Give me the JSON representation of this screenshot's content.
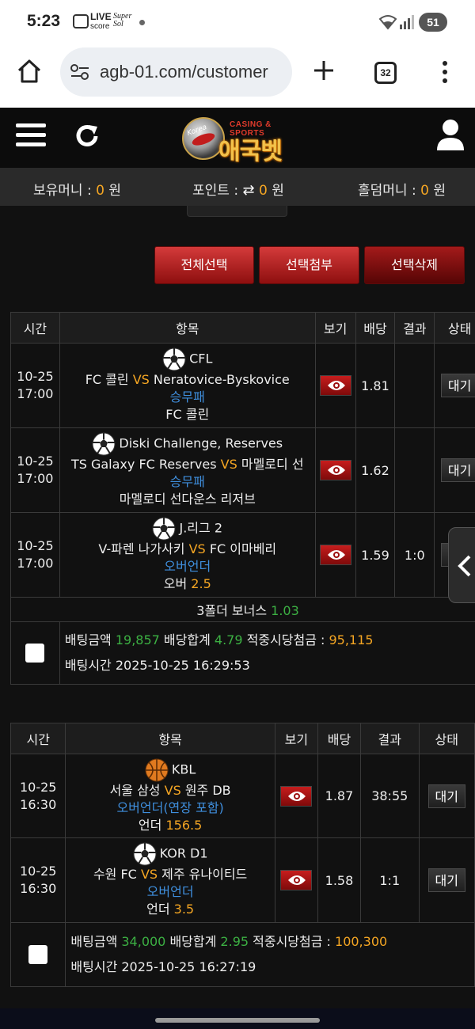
{
  "status_bar": {
    "time": "5:23",
    "live_label": "LIVE",
    "score_label": "score",
    "super_label": "Super",
    "sol_label": "Sol",
    "battery": "51",
    "icons": [
      "screen-record-icon",
      "wifi-icon",
      "signal-icon"
    ]
  },
  "browser": {
    "url": "agb-01.com/customer",
    "tab_count": "32",
    "icons": [
      "home-icon",
      "site-settings-icon",
      "new-tab-icon",
      "tab-switcher-icon",
      "more-vert-icon"
    ]
  },
  "header": {
    "logo_sub": "CASING & SPORTS",
    "logo_main": "애국벳",
    "logo_badge": "Korea",
    "icons": [
      "menu-icon",
      "refresh-icon",
      "user-icon"
    ]
  },
  "balance": {
    "money_label": "보유머니 : ",
    "money_value": "0",
    "money_unit": " 원",
    "point_label": "포인트 : ",
    "point_value": "0",
    "point_unit": " 원",
    "holdem_label": "홀덤머니 : ",
    "holdem_value": "0",
    "holdem_unit": " 원"
  },
  "actions": {
    "select_all": "전체선택",
    "attach_selected": "선택첨부",
    "delete_selected": "선택삭제"
  },
  "table_headers": {
    "time": "시간",
    "item": "항목",
    "view": "보기",
    "odds": "배당",
    "result": "결과",
    "status": "상태"
  },
  "slips": [
    {
      "rows": [
        {
          "date": "10-25",
          "time": "17:00",
          "sport_icon": "soccer-ball-icon",
          "league": "CFL",
          "home": "FC 콜린",
          "vs": "VS",
          "away": "Neratovice-Byskovice",
          "market": "승무패",
          "pick": "FC 콜린",
          "pick_value": "",
          "odds": "1.81",
          "result": "",
          "status": "대기"
        },
        {
          "date": "10-25",
          "time": "17:00",
          "sport_icon": "soccer-ball-icon",
          "league": "Diski Challenge, Reserves",
          "home": "TS Galaxy FC Reserves",
          "vs": "VS",
          "away": "마멜로디 선",
          "market": "승무패",
          "pick": "마멜로디 선다운스 리저브",
          "pick_value": "",
          "odds": "1.62",
          "result": "",
          "status": "대기"
        },
        {
          "date": "10-25",
          "time": "17:00",
          "sport_icon": "soccer-ball-icon",
          "league": "J.리그 2",
          "home": "V-파렌 나가사키",
          "vs": "VS",
          "away": "FC 이마베리",
          "market": "오버언더",
          "pick": "오버",
          "pick_value": "2.5",
          "odds": "1.59",
          "result": "1:0",
          "status": "대기"
        }
      ],
      "bonus_label": "3폴더 보너스 ",
      "bonus_value": "1.03",
      "bet_amount_label": "배팅금액 ",
      "bet_amount": "19,857",
      "odds_total_label": " 배당합계 ",
      "odds_total": "4.79",
      "payout_label": " 적중시당첨금 : ",
      "payout": "95,115",
      "bet_time_label": "배팅시간 ",
      "bet_time": "2025-10-25 16:29:53"
    },
    {
      "rows": [
        {
          "date": "10-25",
          "time": "16:30",
          "sport_icon": "basketball-icon",
          "league": "KBL",
          "home": "서울 삼성",
          "vs": "VS",
          "away": "원주 DB",
          "market": "오버언더(연장 포함)",
          "pick": "언더",
          "pick_value": "156.5",
          "odds": "1.87",
          "result": "38:55",
          "status": "대기"
        },
        {
          "date": "10-25",
          "time": "16:30",
          "sport_icon": "soccer-ball-icon",
          "league": "KOR D1",
          "home": "수원 FC",
          "vs": "VS",
          "away": "제주 유나이티드",
          "market": "오버언더",
          "pick": "언더",
          "pick_value": "3.5",
          "odds": "1.58",
          "result": "1:1",
          "status": "대기"
        }
      ],
      "bonus_label": "",
      "bonus_value": "",
      "bet_amount_label": "배팅금액 ",
      "bet_amount": "34,000",
      "odds_total_label": " 배당합계 ",
      "odds_total": "2.95",
      "payout_label": " 적중시당첨금 : ",
      "payout": "100,300",
      "bet_time_label": "배팅시간 ",
      "bet_time": "2025-10-25 16:27:19"
    }
  ],
  "colors": {
    "accent_red": "#b51c1c",
    "odds_green": "#3cb043",
    "vs_orange": "#f5a623",
    "market_blue": "#3f8fde"
  }
}
